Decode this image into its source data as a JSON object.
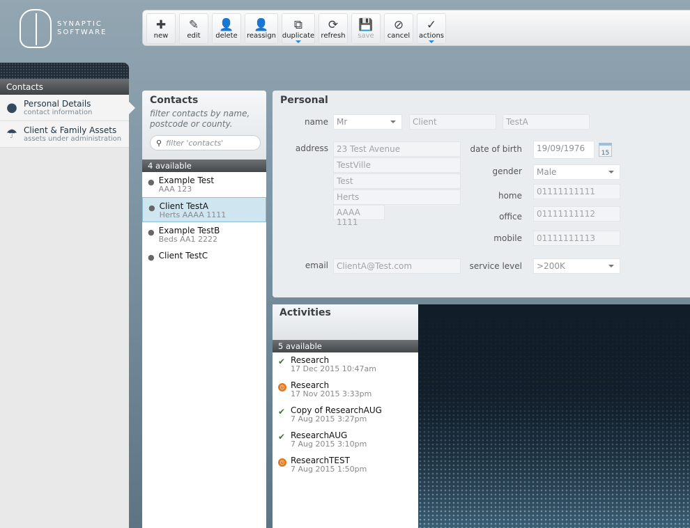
{
  "logo": {
    "line1": "SYNAPTIC",
    "line2": "SOFTWARE"
  },
  "toolbar": [
    {
      "label": "new",
      "icon": "new-document-icon",
      "glyph": "✚",
      "disabled": false
    },
    {
      "label": "edit",
      "icon": "pencil-icon",
      "glyph": "✎",
      "disabled": false
    },
    {
      "label": "delete",
      "icon": "delete-user-icon",
      "glyph": "👤",
      "disabled": false
    },
    {
      "label": "reassign",
      "icon": "reassign-user-icon",
      "glyph": "👤",
      "disabled": false
    },
    {
      "label": "duplicate",
      "icon": "duplicate-icon",
      "glyph": "⧉",
      "disabled": false,
      "dropdown": true
    },
    {
      "label": "refresh",
      "icon": "refresh-icon",
      "glyph": "⟳",
      "disabled": false
    },
    {
      "label": "save",
      "icon": "save-icon",
      "glyph": "💾",
      "disabled": true
    },
    {
      "label": "cancel",
      "icon": "cancel-icon",
      "glyph": "⊘",
      "disabled": false
    },
    {
      "label": "actions",
      "icon": "actions-icon",
      "glyph": "✓",
      "disabled": false,
      "dropdown": true
    }
  ],
  "sidebar": {
    "header": "Contacts",
    "items": [
      {
        "title": "Personal Details",
        "subtitle": "contact information",
        "icon": "person-icon",
        "active": true
      },
      {
        "title": "Client & Family Assets",
        "subtitle": "assets under administration",
        "icon": "umbrella-icon",
        "active": false
      }
    ]
  },
  "contacts": {
    "title": "Contacts",
    "hint": "filter contacts by name, postcode or county.",
    "search_placeholder": "filter 'contacts'",
    "available": "4 available",
    "items": [
      {
        "name": "Example Test",
        "sub": "AAA 123"
      },
      {
        "name": "Client TestA",
        "sub": "Herts AAAA 1111",
        "selected": true
      },
      {
        "name": "Example TestB",
        "sub": "Beds AA1 2222"
      },
      {
        "name": "Client TestC",
        "sub": ""
      }
    ]
  },
  "personal": {
    "title": "Personal",
    "labels": {
      "name": "name",
      "address": "address",
      "email": "email",
      "dob": "date of birth",
      "gender": "gender",
      "home": "home",
      "office": "office",
      "mobile": "mobile",
      "service": "service level"
    },
    "title_value": "Mr",
    "first_name": "Client",
    "last_name": "TestA",
    "address": [
      "23 Test Avenue",
      "TestVille",
      "Test",
      "Herts",
      "AAAA 1111"
    ],
    "email": "ClientA@Test.com",
    "dob": "19/09/1976",
    "calendar_day": "15",
    "gender": "Male",
    "home": "01111111111",
    "office": "01111111112",
    "mobile": "01111111113",
    "service_level": ">200K"
  },
  "activities": {
    "title": "Activities",
    "available": "5 available",
    "items": [
      {
        "name": "Research",
        "date": "17 Dec 2015 10:47am",
        "status": "done"
      },
      {
        "name": "Research",
        "date": "17 Nov 2015 3:33pm",
        "status": "pending"
      },
      {
        "name": "Copy of ResearchAUG",
        "date": "7 Aug 2015 3:27pm",
        "status": "done"
      },
      {
        "name": "ResearchAUG",
        "date": "7 Aug 2015 3:10pm",
        "status": "done"
      },
      {
        "name": "ResearchTEST",
        "date": "7 Aug 2015 1:50pm",
        "status": "pending"
      }
    ]
  }
}
